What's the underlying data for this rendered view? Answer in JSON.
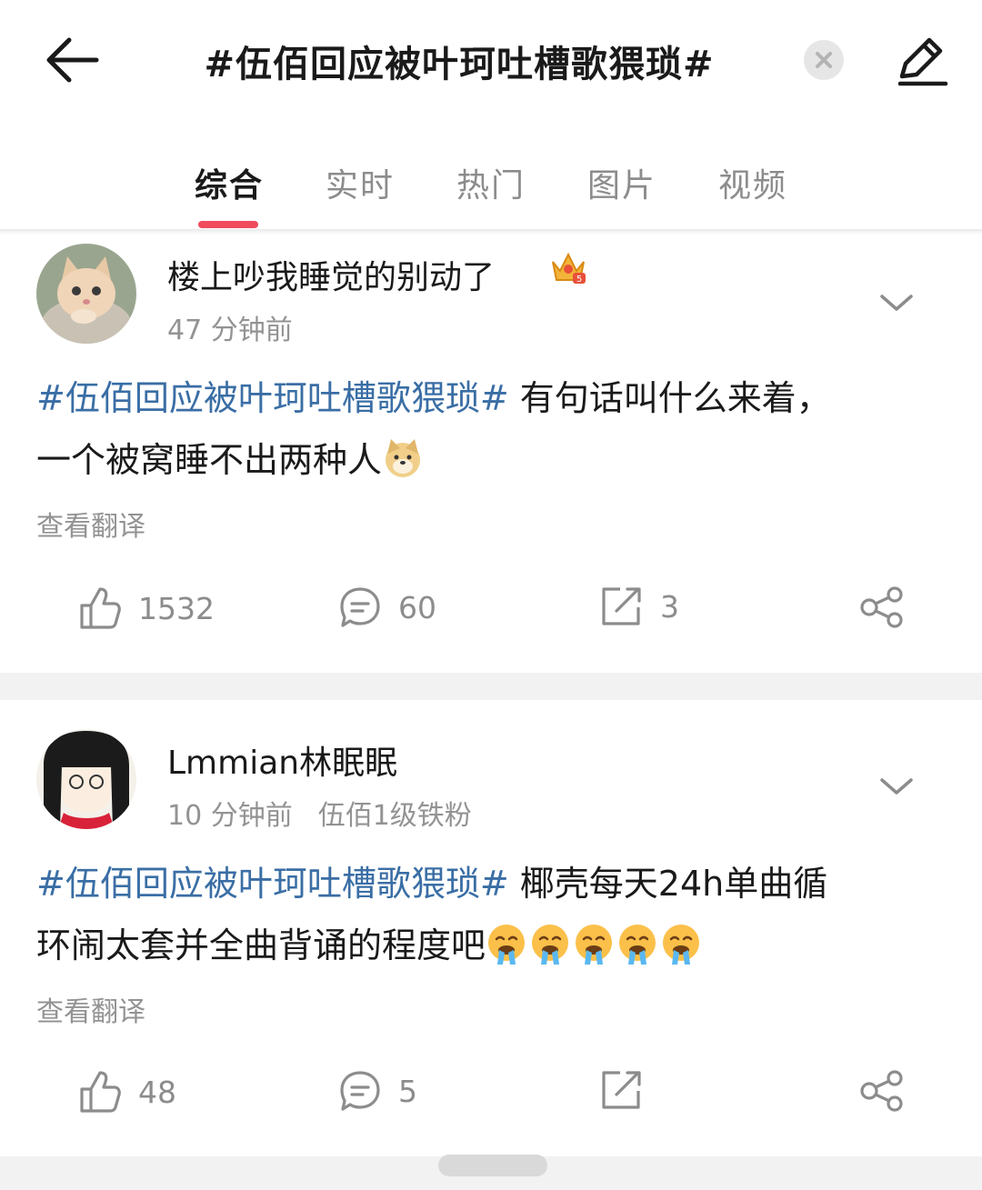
{
  "header": {
    "title": "#伍佰回应被叶珂吐槽歌猥琐#",
    "back_icon": "arrow-left-icon",
    "clear_icon": "close-icon",
    "edit_icon": "pencil-icon"
  },
  "tabs": [
    {
      "label": "综合",
      "active": true
    },
    {
      "label": "实时",
      "active": false
    },
    {
      "label": "热门",
      "active": false
    },
    {
      "label": "图片",
      "active": false
    },
    {
      "label": "视频",
      "active": false
    }
  ],
  "colors": {
    "accent": "#f04a5d",
    "hashtag": "#3a6ea5",
    "muted": "#939393",
    "separator": "#f2f2f2"
  },
  "posts": [
    {
      "username": "楼上吵我睡觉的别动了",
      "time": "47 分钟前",
      "fan_badge": "",
      "badge_icon": "crown-vip-icon",
      "hashtag": "#伍佰回应被叶珂吐槽歌猥琐#",
      "text_line1": " 有句话叫什么来着，",
      "text_line2": "一个被窝睡不出两种人",
      "emoji": "doge-icon",
      "translate": "查看翻译",
      "likes": "1532",
      "comments": "60",
      "reposts": "3"
    },
    {
      "username": "Lmmian林眠眠",
      "time": "10 分钟前",
      "fan_badge": "伍佰1级铁粉",
      "hashtag": "#伍佰回应被叶珂吐槽歌猥琐#",
      "text_line1": " 椰壳每天24h单曲循",
      "text_line2": "环闹太套并全曲背诵的程度吧",
      "emoji": "drooling-face-icon",
      "translate": "查看翻译",
      "likes": "48",
      "comments": "5",
      "reposts": ""
    }
  ]
}
